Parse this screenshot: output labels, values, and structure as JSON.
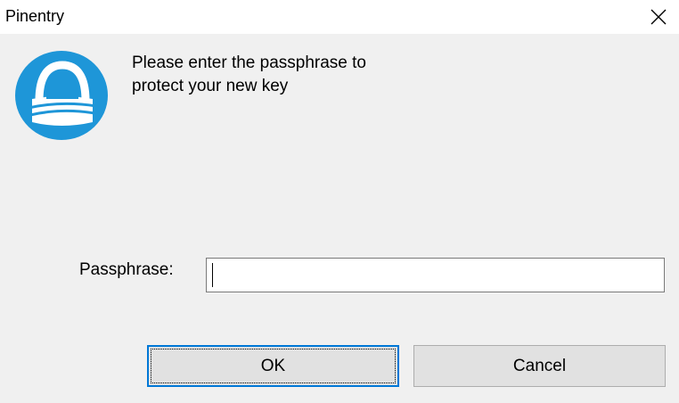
{
  "window": {
    "title": "Pinentry"
  },
  "dialog": {
    "description_line1": "Please enter the passphrase to",
    "description_line2": "protect your new key",
    "passphrase_label": "Passphrase:",
    "passphrase_value": "",
    "logo_icon": "gnupg-lock-icon"
  },
  "buttons": {
    "ok_label": "OK",
    "cancel_label": "Cancel"
  },
  "colors": {
    "logo_blue": "#1e96d8",
    "focus_border": "#0078d7",
    "dialog_bg": "#f0f0f0"
  }
}
